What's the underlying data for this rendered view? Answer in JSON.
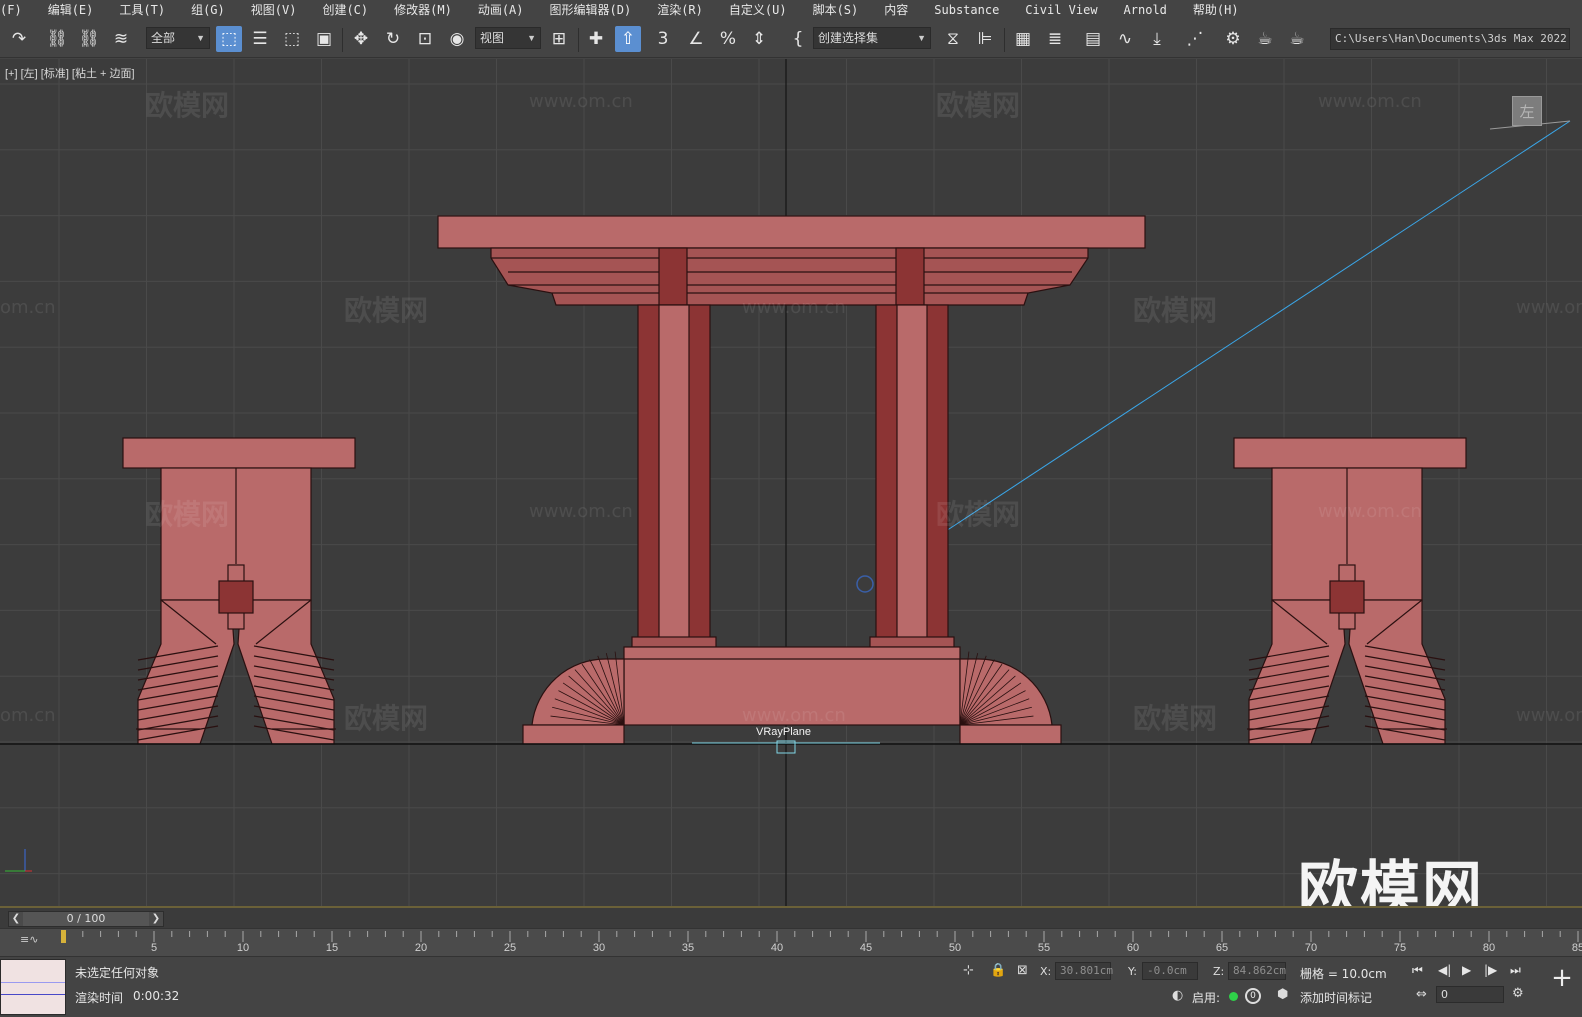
{
  "menu": [
    "(F)",
    "编辑(E)",
    "工具(T)",
    "组(G)",
    "视图(V)",
    "创建(C)",
    "修改器(M)",
    "动画(A)",
    "图形编辑器(D)",
    "渲染(R)",
    "自定义(U)",
    "脚本(S)",
    "内容",
    "Substance",
    "Civil View",
    "Arnold",
    "帮助(H)"
  ],
  "toolbar": {
    "filter_combo": "全部",
    "coord_combo": "视图",
    "selection_set_combo": "创建选择集",
    "project_path": "C:\\Users\\Han\\Documents\\3ds Max 2022",
    "snap_label": "3"
  },
  "viewport": {
    "label": "[+] [左] [标准] [粘土 + 边面]",
    "viewcube_face": "左",
    "object_label": "VRayPlane",
    "brand": "欧模网",
    "watermark_text": "欧模网",
    "watermark_url": "www.om.cn",
    "watermark_url_short": "om.cn",
    "colors": {
      "background": "#3c3c3c",
      "grid": "#4a4a4a",
      "model_face": "#b96a6a",
      "model_dark": "#8c3434",
      "model_edge": "#2a1010",
      "camera_line": "#3aa6e8"
    }
  },
  "timeline": {
    "frame_display": "0 / 100",
    "ticks": [
      "5",
      "10",
      "15",
      "20",
      "25",
      "30",
      "35",
      "40",
      "45",
      "50",
      "55",
      "60",
      "65",
      "70",
      "75",
      "80",
      "85"
    ]
  },
  "status": {
    "message": "未选定任何对象",
    "render_time_label": "渲染时间",
    "render_time_value": "0:00:32",
    "x_label": "X:",
    "x_value": "30.801cm",
    "y_label": "Y:",
    "y_value": "-0.0cm",
    "z_label": "Z:",
    "z_value": "84.862cm",
    "grid_info": "栅格 = 10.0cm",
    "enable_label": "启用:",
    "key_count": "0",
    "add_time_tag": "添加时间标记",
    "current_frame": "0"
  }
}
